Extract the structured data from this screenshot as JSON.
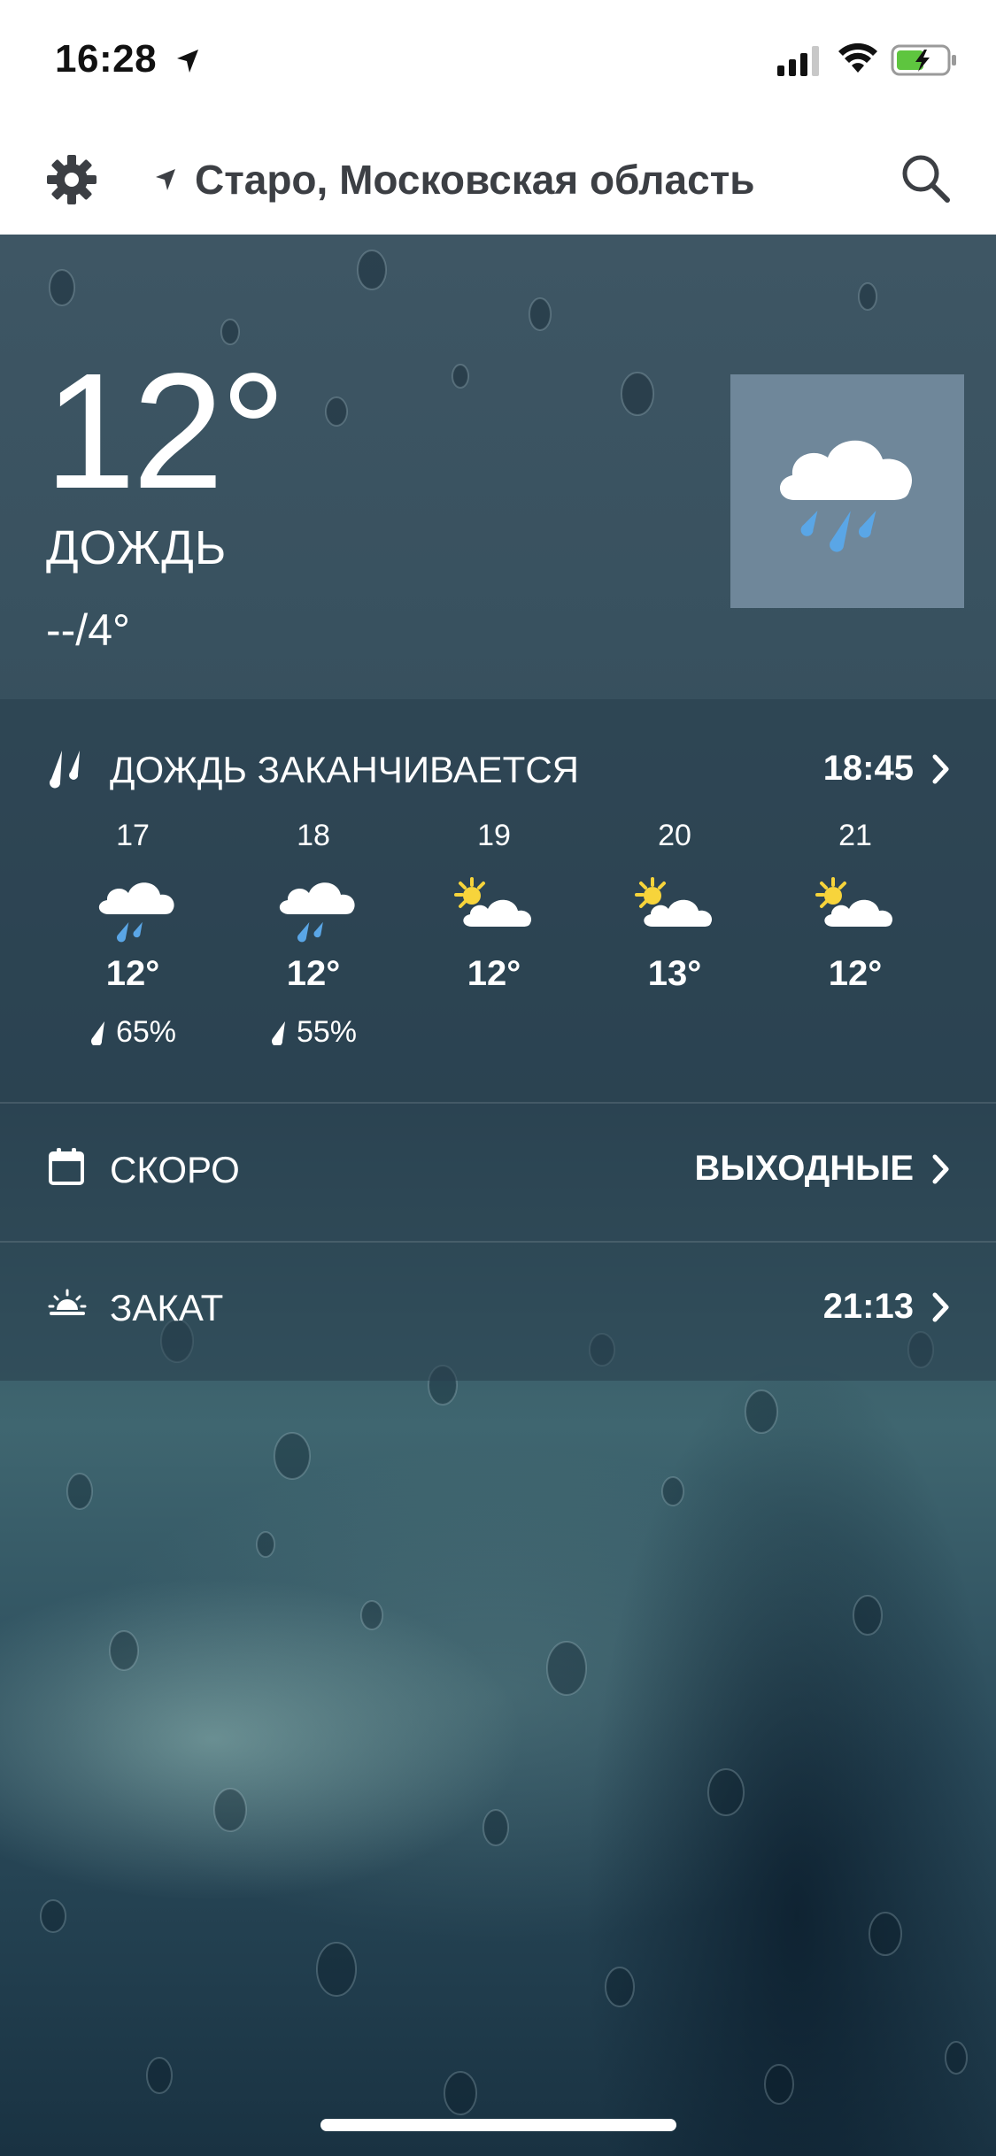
{
  "status_bar": {
    "time": "16:28"
  },
  "header": {
    "location": "Старо, Московская область"
  },
  "current": {
    "temperature": "12°",
    "condition": "ДОЖДЬ",
    "min_max": "--/4°"
  },
  "rain_row": {
    "label": "ДОЖДЬ ЗАКАНЧИВАЕТСЯ",
    "value": "18:45"
  },
  "hourly": [
    {
      "time": "17",
      "icon": "rain-icon",
      "temp": "12°",
      "precip": "65%"
    },
    {
      "time": "18",
      "icon": "rain-icon",
      "temp": "12°",
      "precip": "55%"
    },
    {
      "time": "19",
      "icon": "partly-cloudy-icon",
      "temp": "12°",
      "precip": ""
    },
    {
      "time": "20",
      "icon": "partly-cloudy-icon",
      "temp": "13°",
      "precip": ""
    },
    {
      "time": "21",
      "icon": "partly-cloudy-icon",
      "temp": "12°",
      "precip": ""
    }
  ],
  "soon_row": {
    "label": "СКОРО",
    "value": "ВЫХОДНЫЕ"
  },
  "sunset_row": {
    "label": "ЗАКАТ",
    "value": "21:13"
  },
  "colors": {
    "header_bg": "#ffffff",
    "panel": "#2a4050",
    "rain_blue": "#5aa6e6",
    "sun_yellow": "#f7d43b"
  }
}
